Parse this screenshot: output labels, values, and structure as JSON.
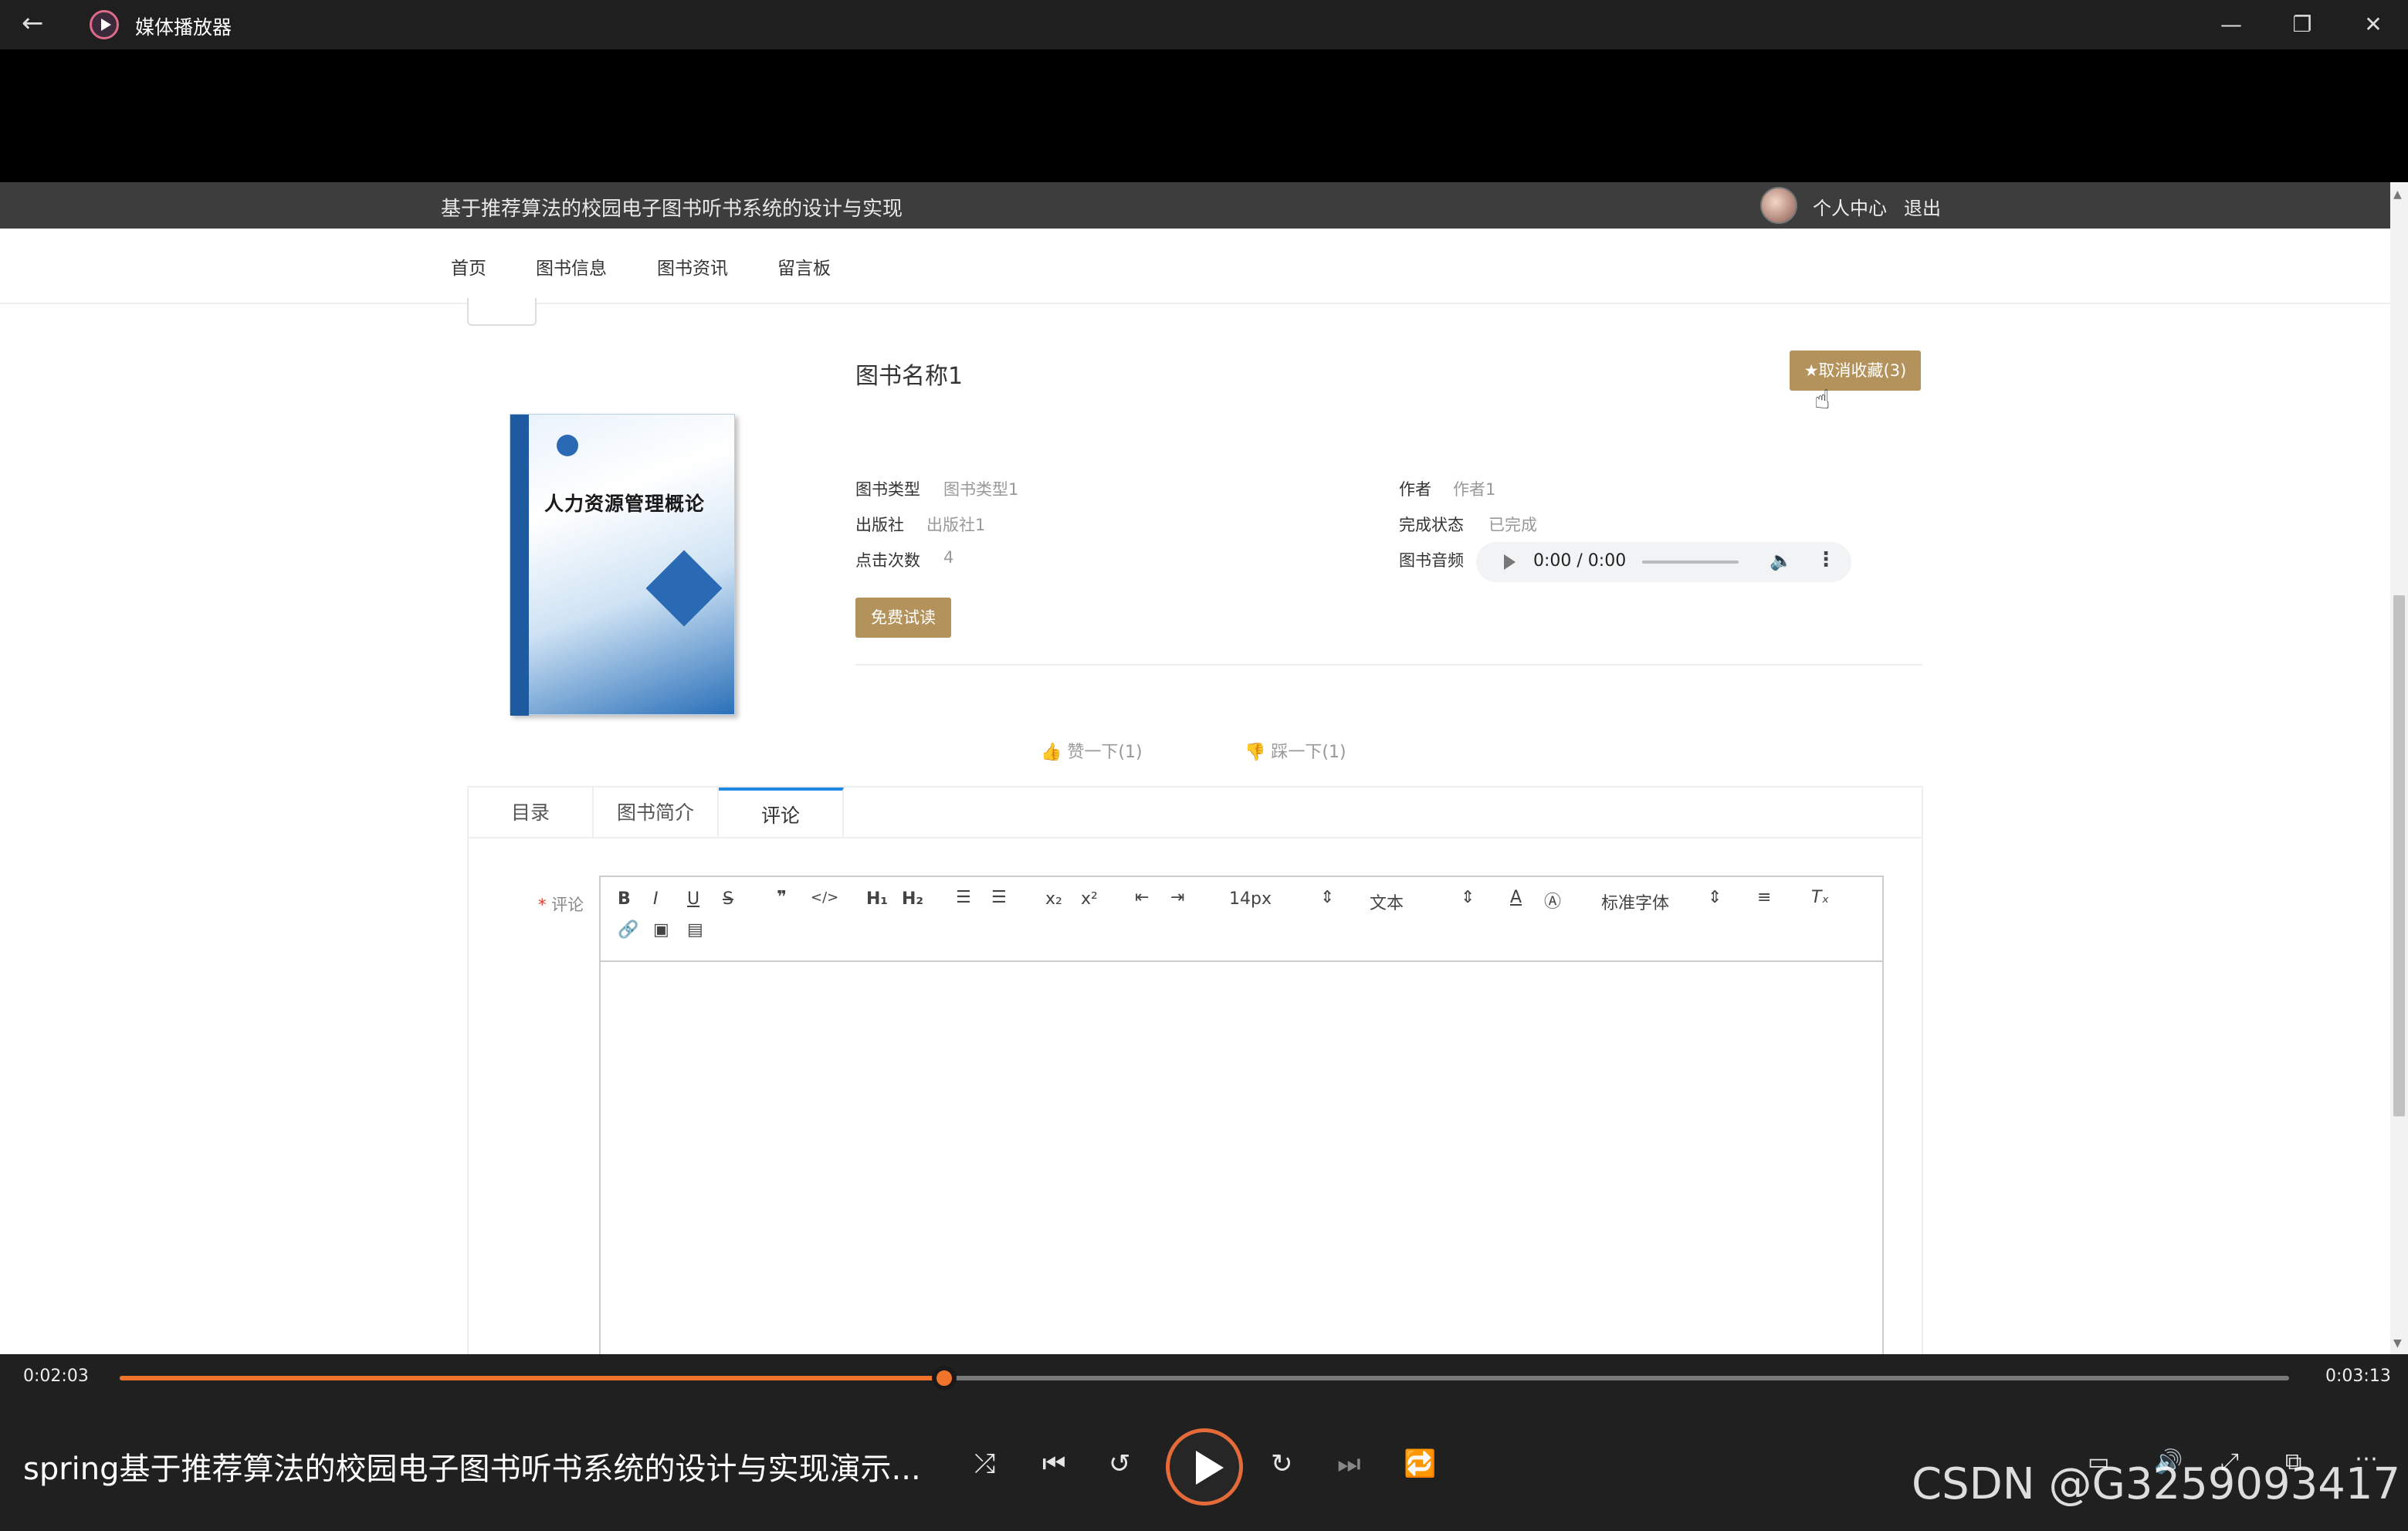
{
  "window": {
    "app_title": "媒体播放器",
    "back_icon": "←",
    "minimize": "—",
    "restore": "❐",
    "close": "✕"
  },
  "site": {
    "title": "基于推荐算法的校园电子图书听书系统的设计与实现",
    "user_center": "个人中心",
    "logout": "退出",
    "nav": [
      "首页",
      "图书信息",
      "图书资讯",
      "留言板"
    ]
  },
  "book": {
    "cover_title": "人力资源管理概论",
    "name": "图书名称1",
    "favorite_label": "★取消收藏(3)",
    "fields": {
      "type_label": "图书类型",
      "type_value": "图书类型1",
      "publisher_label": "出版社",
      "publisher_value": "出版社1",
      "clicks_label": "点击次数",
      "clicks_value": "4",
      "author_label": "作者",
      "author_value": "作者1",
      "status_label": "完成状态",
      "status_value": "已完成",
      "audio_label": "图书音频"
    },
    "audio_time": "0:00 / 0:00",
    "free_trial": "免费试读",
    "like": "赞一下(1)",
    "dislike": "踩一下(1)"
  },
  "tabs": [
    "目录",
    "图书简介",
    "评论"
  ],
  "comment": {
    "required_mark": "*",
    "label": "评论",
    "font_size": "14px",
    "block_type": "文本",
    "font_family": "标准字体"
  },
  "player": {
    "elapsed": "0:02:03",
    "total": "0:03:13",
    "progress": 0.38,
    "video_title": "spring基于推荐算法的校园电子图书听书系统的设计与实现演示...",
    "watermark": "CSDN @G3259093417",
    "accent": "#f0742a"
  },
  "colors": {
    "gold_button": "#b3935b",
    "tab_active": "#1e88e5"
  }
}
